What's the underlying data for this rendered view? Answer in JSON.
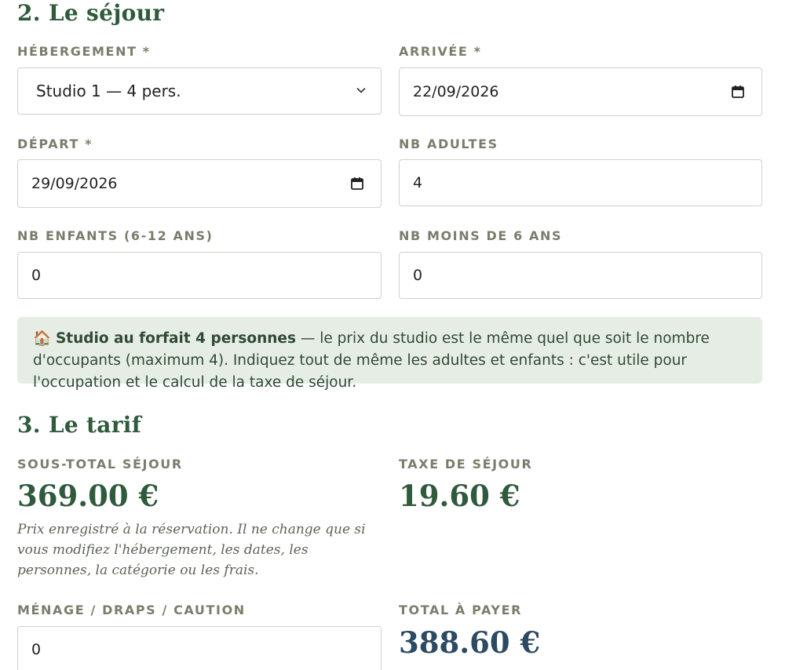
{
  "sections": {
    "sejour_title": "2. Le séjour",
    "tarif_title": "3. Le tarif"
  },
  "fields": {
    "hebergement": {
      "label": "HÉBERGEMENT *",
      "value": "Studio 1 — 4 pers."
    },
    "arrivee": {
      "label": "ARRIVÉE *",
      "value": "22/09/2026"
    },
    "depart": {
      "label": "DÉPART *",
      "value": "29/09/2026"
    },
    "nb_adultes": {
      "label": "NB ADULTES",
      "value": "4"
    },
    "nb_enfants": {
      "label": "NB ENFANTS (6-12 ANS)",
      "value": "0"
    },
    "nb_moins6": {
      "label": "NB MOINS DE 6 ANS",
      "value": "0"
    },
    "menage": {
      "label": "MÉNAGE / DRAPS / CAUTION",
      "value": "0"
    }
  },
  "notice": {
    "icon": "🏠",
    "bold": "Studio au forfait 4 personnes",
    "text": " — le prix du studio est le même quel que soit le nombre d'occupants (maximum 4). Indiquez tout de même les adultes et enfants : c'est utile pour l'occupation et le calcul de la taxe de séjour."
  },
  "tarif": {
    "sous_total_label": "SOUS-TOTAL SÉJOUR",
    "sous_total_value": "369.00 €",
    "taxe_label": "TAXE DE SÉJOUR",
    "taxe_value": "19.60 €",
    "note": "Prix enregistré à la réservation. Il ne change que si vous modifiez l'hébergement, les dates, les personnes, la catégorie ou les frais.",
    "total_label": "TOTAL À PAYER",
    "total_value": "388.60 €"
  },
  "colors": {
    "accent_green": "#2f5a3c",
    "accent_blue": "#2c4a63",
    "notice_bg": "#e6ede4",
    "label_grey": "#7b7d6c"
  }
}
